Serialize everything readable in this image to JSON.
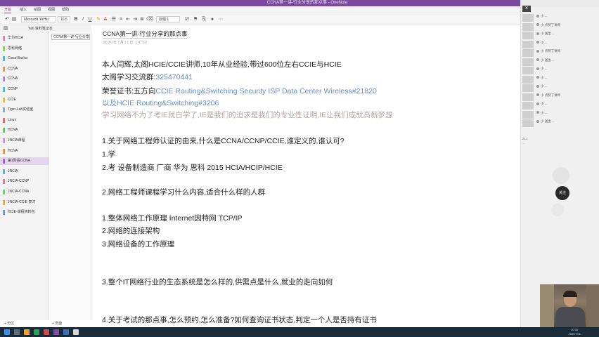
{
  "window": {
    "title": "CCNA第一讲-行业分享的那点事 - OneNote"
  },
  "tabs": [
    {
      "label": "开始",
      "active": true
    },
    {
      "label": "插入",
      "active": false
    },
    {
      "label": "绘图",
      "active": false
    },
    {
      "label": "视图",
      "active": false
    },
    {
      "label": "帮助",
      "active": false
    }
  ],
  "ribbon": {
    "font_name": "Microsoft YaHei",
    "font_size": "10.5",
    "heading_style": "标题 1"
  },
  "notebook": {
    "name": "Yan 资料笔记本"
  },
  "sections": [
    {
      "label": "华为HCIA",
      "color": "#d98bb4"
    },
    {
      "label": "思科网络",
      "color": "#9ec36c"
    },
    {
      "label": "Cisco Basics",
      "color": "#6fa8dc"
    },
    {
      "label": "CCNA",
      "color": "#e59a5b"
    },
    {
      "label": "CCNA",
      "color": "#b68ad6"
    },
    {
      "label": "CCNP",
      "color": "#67c1b7"
    },
    {
      "label": "CCIE",
      "color": "#e0c34f"
    },
    {
      "label": "Tiger-Lab实验室",
      "color": "#8da6d6"
    },
    {
      "label": "Linux",
      "color": "#d77474"
    },
    {
      "label": "HCNA",
      "color": "#7fbf7f"
    },
    {
      "label": "JNCIA课程",
      "color": "#c89bd8"
    },
    {
      "label": "HCNA",
      "color": "#e0a05a"
    },
    {
      "label": "第1阶段CCNA",
      "color": "#9a6cc3",
      "active": true
    },
    {
      "label": "JNCIA",
      "color": "#6cb0d9"
    },
    {
      "label": "JNCIA-CCNP",
      "color": "#d9849b"
    },
    {
      "label": "JNCIA-CCNA",
      "color": "#8bc48a"
    },
    {
      "label": "JNCIA-CCIE 复习",
      "color": "#e5b25a"
    },
    {
      "label": "HCIE-课程资料包",
      "color": "#7d9cd6"
    }
  ],
  "pages": [
    {
      "label": "CCNA第一讲-行业分享",
      "selected": true
    }
  ],
  "bottom": {
    "add_section": "+ 分区",
    "add_page": "+ 页面"
  },
  "page": {
    "title": "CCNA第一讲-行业分享的那点事",
    "date": "2020年7月11日    14:12",
    "lines": [
      {
        "id": "l1",
        "text": "本人闫辉,太阁HCIE/CCIE讲师,10年从业经验,带过600位左右CCIE与HCIE"
      },
      {
        "id": "l2a",
        "text": "太阁学习交流群:"
      },
      {
        "id": "l2b",
        "text": "325470441"
      },
      {
        "id": "l3a",
        "text": "荣誉证书:五方向"
      },
      {
        "id": "l3b",
        "text": "CCIE Routing&Switching Security ISP Data Center Wireless#21820"
      },
      {
        "id": "l4",
        "text": "以及HCIE Routing&Switching#3206"
      },
      {
        "id": "l5",
        "text": "学习网络不为了考IE就白学了,IE是我们的追求是我们的专业性证明,IE让我们成就高薪梦想"
      },
      {
        "id": "l6",
        "text": "1.关于网络工程师认证的由来,什么是CCNA/CCNP/CCIE,谁定义的,谁认可?"
      },
      {
        "id": "l7",
        "text": "1.学"
      },
      {
        "id": "l8",
        "text": "2.考  设备制造商 厂商 华为 思科   2015 HCIA/HCIP/HCIE"
      },
      {
        "id": "l9",
        "text": "2.网络工程师课程学习什么内容,适合什么样的人群"
      },
      {
        "id": "l10",
        "text": "1.整体网络工作原理   Internet因特网   TCP/IP"
      },
      {
        "id": "l11",
        "text": "2.网络的连接架构"
      },
      {
        "id": "l12",
        "text": "3.网络设备的工作原理"
      },
      {
        "id": "l13",
        "text": "3.整个IT网络行业的生态系统是怎么样的,供需点是什么,就业的走向如何"
      },
      {
        "id": "l14",
        "text": "4.关于考试的那点事,怎么预约,怎么准备?如何查询证书状态,判定一个人是否持有证书"
      }
    ]
  },
  "chat": {
    "messages": [
      "小 ...",
      "小 点赞了讲师",
      "小 送出 ...",
      "小 ...",
      "小 点赞了讲师",
      "小 送出 ...",
      "小 ...",
      "小 ...",
      "小 ...",
      "小 点赞了讲师",
      "小 ...",
      "小 ...",
      "小 送出 ..."
    ],
    "side_text": "21:1 ...",
    "circle_label": "关注"
  },
  "taskbar": {
    "time": "20:30",
    "date": "2020/7/11"
  }
}
